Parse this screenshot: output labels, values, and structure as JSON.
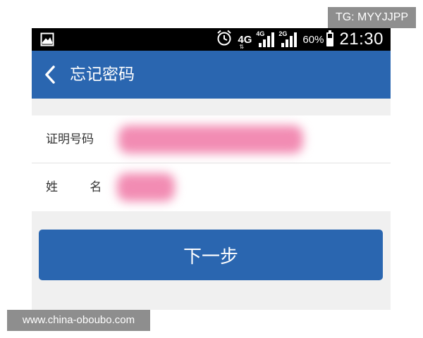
{
  "watermark": {
    "top": "TG: MYYJJPP",
    "bottom": "www.china-oboubo.com"
  },
  "status_bar": {
    "network_1": "4G",
    "network_2": "4G",
    "network_3": "2G",
    "battery_percent": "60%",
    "battery_level": 0.6,
    "time": "21:30",
    "icons": [
      "image-icon",
      "alarm-icon",
      "signal-icon",
      "signal-icon",
      "battery-icon"
    ]
  },
  "header": {
    "title": "忘记密码",
    "back_icon": "chevron-left-icon",
    "color": "#2a66b0"
  },
  "form": {
    "id_label": "证明号码",
    "name_label": "姓 名",
    "id_value_redacted": true,
    "name_value_redacted": true
  },
  "next_button": {
    "label": "下一步",
    "color": "#2a66b0"
  }
}
